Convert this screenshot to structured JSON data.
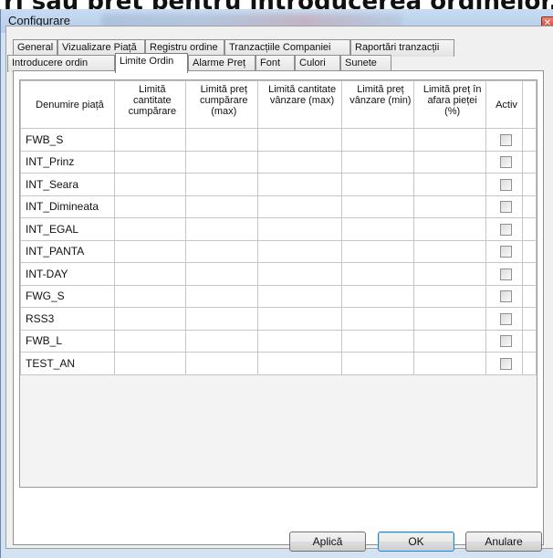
{
  "background_text": "ri sau preț pentru introducerea ordinelor.",
  "window": {
    "title": "Configurare",
    "close_glyph": "✕"
  },
  "tabs_row1": [
    "General",
    "Vizualizare Piață",
    "Registru ordine",
    "Tranzacțiile Companiei",
    "Raportări tranzacții"
  ],
  "tabs_row2": [
    "Introducere ordin",
    "Limite Ordin",
    "Alarme Preț",
    "Font",
    "Culori",
    "Sunete"
  ],
  "active_tab": "Limite Ordin",
  "table": {
    "headers": [
      "Denumire piață",
      "Limită cantitate cumpărare",
      "Limită preț cumpărare (max)",
      "Limită cantitate vânzare (max)",
      "Limită preț vânzare (min)",
      "Limită preț în afara pieței (%)",
      "Activ"
    ],
    "rows": [
      "FWB_S",
      "INT_Prinz",
      "INT_Seara",
      "INT_Dimineata",
      "INT_EGAL",
      "INT_PANTA",
      "INT-DAY",
      "FWG_S",
      "RSS3",
      "FWB_L",
      "TEST_AN"
    ]
  },
  "buttons": {
    "apply": "Aplică",
    "ok": "OK",
    "cancel": "Anulare"
  },
  "colors": {
    "window_frame": "#d4e3f4",
    "panel": "#f0f0f0",
    "default_button_border": "#3c7fb1"
  }
}
